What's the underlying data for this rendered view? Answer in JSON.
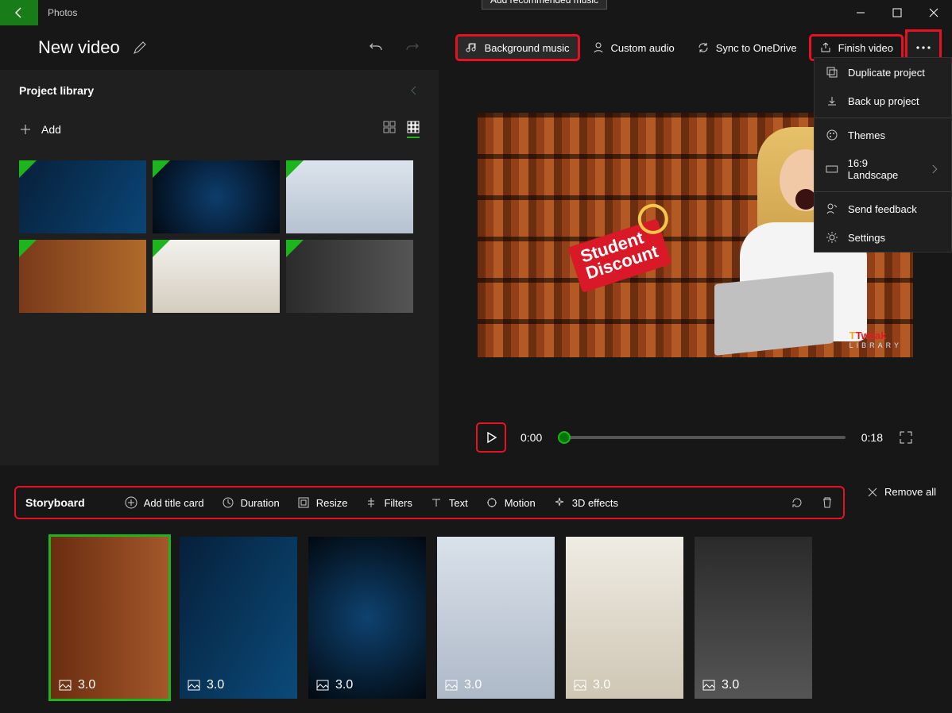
{
  "app_name": "Photos",
  "project_title": "New video",
  "tooltip_music": "Add recommended music",
  "toolbar": {
    "bg_music": "Background music",
    "custom_audio": "Custom audio",
    "sync": "Sync to OneDrive",
    "finish": "Finish video"
  },
  "menu": {
    "duplicate": "Duplicate project",
    "backup": "Back up project",
    "themes": "Themes",
    "aspect": "16:9 Landscape",
    "feedback": "Send feedback",
    "settings": "Settings"
  },
  "library": {
    "title": "Project library",
    "add": "Add"
  },
  "preview": {
    "badge_line1": "Student",
    "badge_line2": "Discount",
    "brand": "Tweak",
    "brand_sub": "LIBRARY",
    "time_current": "0:00",
    "time_total": "0:18"
  },
  "storyboard": {
    "title": "Storyboard",
    "add_title": "Add title card",
    "duration": "Duration",
    "resize": "Resize",
    "filters": "Filters",
    "text": "Text",
    "motion": "Motion",
    "fx": "3D effects",
    "remove_all": "Remove all",
    "clip_dur": "3.0"
  }
}
